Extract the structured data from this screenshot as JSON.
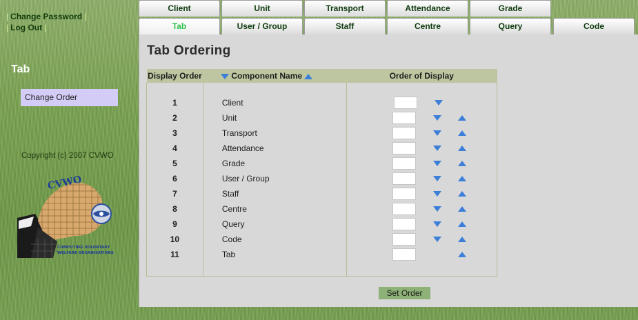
{
  "header": {
    "change_password": "Change Password",
    "log_out": "Log Out",
    "sep": "|"
  },
  "sidebar": {
    "title": "Tab",
    "items": [
      {
        "label": "Change Order"
      }
    ],
    "copyright": "Copyright (c) 2007 CVWO"
  },
  "logo": {
    "top_text": "CVWO",
    "line1": "COMPUTING VOLUNTARY",
    "line2": "WELFARE ORGANISATIONS"
  },
  "tabs": {
    "row1": [
      "Client",
      "Unit",
      "Transport",
      "Attendance",
      "Grade"
    ],
    "row2": [
      "Tab",
      "User / Group",
      "Staff",
      "Centre",
      "Query",
      "Code"
    ],
    "active": "Tab"
  },
  "page": {
    "title": "Tab Ordering"
  },
  "table": {
    "headers": {
      "display_order": "Display Order",
      "component_name": "Component Name",
      "order_of_display": "Order of Display"
    },
    "rows": [
      {
        "order": "1",
        "name": "Client"
      },
      {
        "order": "2",
        "name": "Unit"
      },
      {
        "order": "3",
        "name": "Transport"
      },
      {
        "order": "4",
        "name": "Attendance"
      },
      {
        "order": "5",
        "name": "Grade"
      },
      {
        "order": "6",
        "name": "User / Group"
      },
      {
        "order": "7",
        "name": "Staff"
      },
      {
        "order": "8",
        "name": "Centre"
      },
      {
        "order": "9",
        "name": "Query"
      },
      {
        "order": "10",
        "name": "Code"
      },
      {
        "order": "11",
        "name": "Tab"
      }
    ]
  },
  "actions": {
    "set_order": "Set Order"
  },
  "colors": {
    "tab_active": "#2ec24a",
    "tab_text": "#0e3a0e",
    "sidebar_selected": "#d2ccf6",
    "header_bg": "#bdc6a0",
    "button_bg": "#8db176",
    "arrow_blue": "#3d7fd8"
  }
}
